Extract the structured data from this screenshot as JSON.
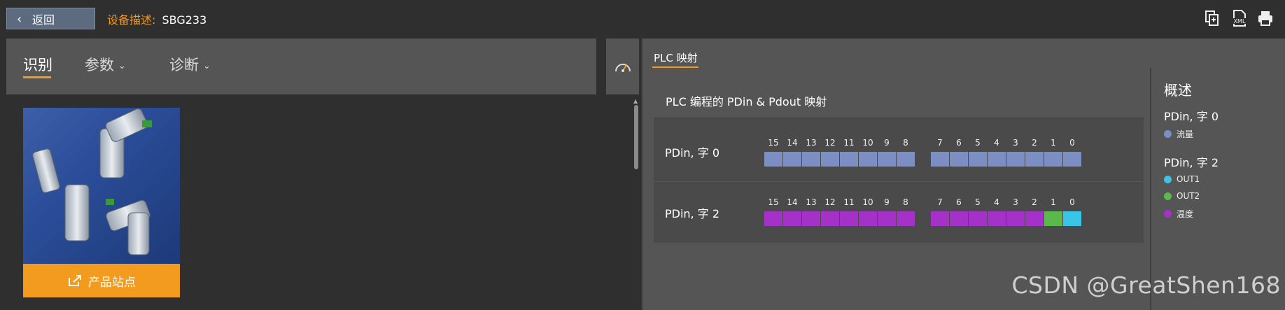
{
  "header": {
    "back_label": "返回",
    "device_label": "设备描述:",
    "device_name": "SBG233",
    "icons": [
      "export-icon",
      "xml-icon",
      "print-icon"
    ]
  },
  "left": {
    "tabs": [
      {
        "label": "识别",
        "active": true
      },
      {
        "label": "参数",
        "active": false,
        "caret": "⌄"
      },
      {
        "label": "诊断",
        "active": false,
        "caret": "⌄"
      }
    ],
    "product_link_label": "产品站点"
  },
  "plc": {
    "tab_label": "PLC 映射",
    "card_title": "PLC 编程的 PDin & Pdout 映射",
    "bit_numbers_high": [
      "15",
      "14",
      "13",
      "12",
      "11",
      "10",
      "9",
      "8"
    ],
    "bit_numbers_low": [
      "7",
      "6",
      "5",
      "4",
      "3",
      "2",
      "1",
      "0"
    ],
    "rows": [
      {
        "label": "PDin, 字 0",
        "bits": [
          "flow",
          "flow",
          "flow",
          "flow",
          "flow",
          "flow",
          "flow",
          "flow",
          "flow",
          "flow",
          "flow",
          "flow",
          "flow",
          "flow",
          "flow",
          "flow"
        ]
      },
      {
        "label": "PDin, 字 2",
        "bits": [
          "temp",
          "temp",
          "temp",
          "temp",
          "temp",
          "temp",
          "temp",
          "temp",
          "temp",
          "temp",
          "temp",
          "temp",
          "temp",
          "temp",
          "out2",
          "out1"
        ]
      }
    ]
  },
  "overview": {
    "title": "概述",
    "groups": [
      {
        "name": "PDin, 字 0",
        "items": [
          {
            "label": "流量",
            "key": "flow"
          }
        ]
      },
      {
        "name": "PDin, 字 2",
        "items": [
          {
            "label": "OUT1",
            "key": "out1"
          },
          {
            "label": "OUT2",
            "key": "out2"
          },
          {
            "label": "温度",
            "key": "temp"
          }
        ]
      }
    ]
  },
  "colors": {
    "accent": "#f29b1e",
    "flow": "#7b8fc4",
    "temp": "#a431c8",
    "out1": "#38c5e8",
    "out2": "#5bb84a"
  },
  "watermark": "CSDN @GreatShen168"
}
